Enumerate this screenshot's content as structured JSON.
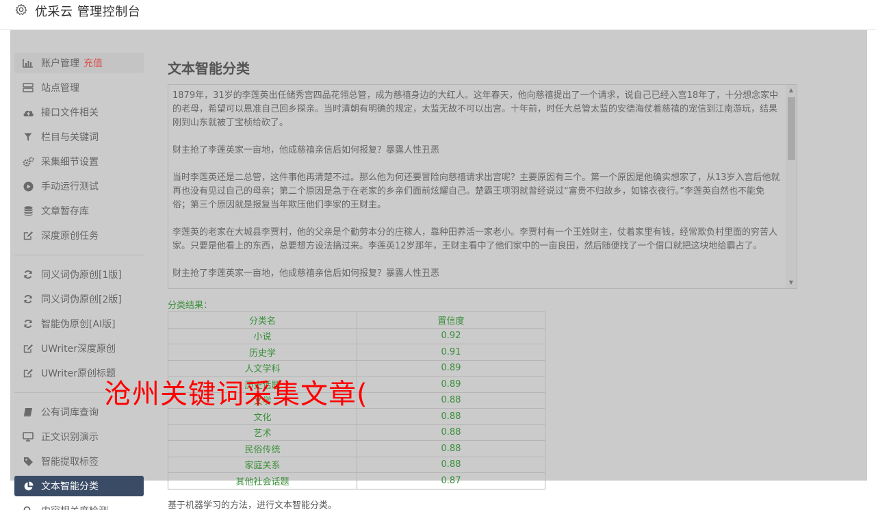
{
  "header": {
    "title": "优采云 管理控制台",
    "icon": "gear-icon"
  },
  "sidebar": {
    "groups": [
      [
        {
          "label": "账户管理",
          "extra": "充值",
          "icon": "bar-chart-icon"
        },
        {
          "label": "站点管理",
          "icon": "server-icon"
        },
        {
          "label": "接口文件相关",
          "icon": "cloud-upload-icon"
        },
        {
          "label": "栏目与关键词",
          "icon": "filter-icon"
        },
        {
          "label": "采集细节设置",
          "icon": "gears-icon"
        },
        {
          "label": "手动运行测试",
          "icon": "play-circle-icon"
        },
        {
          "label": "文章暂存库",
          "icon": "database-icon"
        },
        {
          "label": "深度原创任务",
          "icon": "edit-icon"
        }
      ],
      [
        {
          "label": "同义词伪原创[1版]",
          "icon": "refresh-icon"
        },
        {
          "label": "同义词伪原创[2版]",
          "icon": "refresh-icon"
        },
        {
          "label": "智能伪原创[AI版]",
          "icon": "refresh-icon"
        },
        {
          "label": "UWriter深度原创",
          "icon": "edit-icon"
        },
        {
          "label": "UWriter原创标题",
          "icon": "edit-icon"
        }
      ],
      [
        {
          "label": "公有词库查询",
          "icon": "book-icon"
        },
        {
          "label": "正文识别演示",
          "icon": "monitor-icon"
        },
        {
          "label": "智能提取标签",
          "icon": "tag-icon"
        },
        {
          "label": "文本智能分类",
          "icon": "pie-chart-icon"
        },
        {
          "label": "内容相关度检测",
          "icon": "search-icon"
        }
      ]
    ]
  },
  "main": {
    "title": "文本智能分类",
    "paragraphs": [
      "1879年，31岁的李莲英出任储秀宫四品花翎总管，成为慈禧身边的大红人。这年春天，他向慈禧提出了一个请求，说自己已经入宫18年了，十分想念家中的老母，希望可以恩准自己回乡探亲。当时清朝有明确的规定，太监无故不可以出宫。十年前，时任大总管太监的安德海仗着慈禧的宠信到江南游玩，结果刚到山东就被丁宝桢给砍了。",
      "财主抢了李莲英家一亩地，他成慈禧亲信后如何报复？暴露人性丑恶",
      "当时李莲英还是二总管，这件事他再清楚不过。那么他为何还要冒险向慈禧请求出宫呢？主要原因有三个。第一个原因是他确实想家了，从13岁入宫后他就再也没有见过自己的母亲；第二个原因是急于在老家的乡亲们面前炫耀自己。楚霸王项羽就曾经说过“富贵不归故乡，如锦衣夜行。”李莲英自然也不能免俗；第三个原因就是报复当年欺压他们李家的王财主。",
      "李莲英的老家在大城县李贾村，他的父亲是个勤劳本分的庄稼人，靠种田养活一家老小。李贾村有一个王姓财主，仗着家里有钱，经常欺负村里面的穷苦人家。只要是他看上的东西，总要想方设法搞过来。李莲英12岁那年，王财主看中了他们家中的一亩良田，然后随便找了一个借口就把这块地给霸占了。",
      "财主抢了李莲英家一亩地，他成慈禧亲信后如何报复？暴露人性丑恶"
    ],
    "result_label": "分类结果：",
    "columns": [
      "分类名",
      "置信度"
    ],
    "rows": [
      [
        "小说",
        "0.92"
      ],
      [
        "历史学",
        "0.91"
      ],
      [
        "人文学科",
        "0.89"
      ],
      [
        "历史话题",
        "0.89"
      ],
      [
        "文学",
        "0.88"
      ],
      [
        "文化",
        "0.88"
      ],
      [
        "艺术",
        "0.88"
      ],
      [
        "民俗传统",
        "0.88"
      ],
      [
        "家庭关系",
        "0.88"
      ],
      [
        "其他社会话题",
        "0.87"
      ]
    ],
    "description": "基于机器学习的方法，进行文本智能分类。"
  },
  "watermark": "沧州关键词采集文章(",
  "colors": {
    "overlay": "#cbcbcb",
    "active_bg": "#3a4b66",
    "result_green": "#3a8f3a",
    "recharge_red": "#d9534f",
    "watermark_red": "#ff0000"
  }
}
